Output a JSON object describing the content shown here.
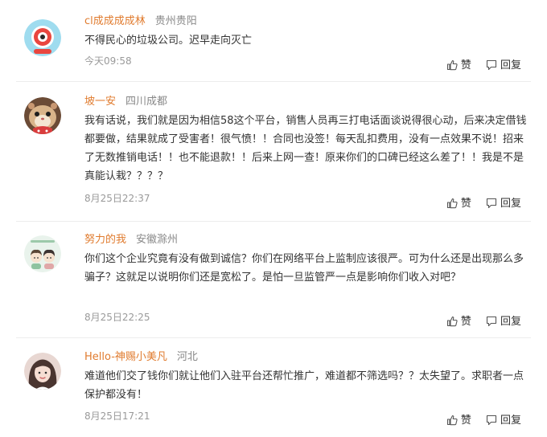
{
  "comments": [
    {
      "username": "cl成成成成林",
      "location": "贵州贵阳",
      "text": "不得民心的垃圾公司。迟早走向灭亡",
      "time": "今天09:58",
      "like_label": "赞",
      "reply_label": "回复"
    },
    {
      "username": "坡一安",
      "location": "四川成都",
      "text": "我有话说，我们就是因为相信58这个平台，销售人员再三打电话面谈说得很心动，后来决定借钱都要做，结果就成了受害者！很气愤！！合同也没签！每天乱扣费用，没有一点效果不说！招来了无数推销电话！！也不能退款！！后来上网一查！原来你们的口碑已经这么差了！！我是不是真能认栽？？？？",
      "time": "8月25日22:37",
      "like_label": "赞",
      "reply_label": "回复"
    },
    {
      "username": "努力的我",
      "location": "安徽滁州",
      "text": "你们这个企业究竟有没有做到诚信？你们在网络平台上监制应该很严。可为什么还是出现那么多骗子？这就足以说明你们还是宽松了。是怕一旦监管严一点是影响你们收入对吧？",
      "time": "8月25日22:25",
      "like_label": "赞",
      "reply_label": "回复"
    },
    {
      "username": "Hello-神赐小美凡",
      "location": "河北",
      "text": "难道他们交了钱你们就让他们入驻平台还帮忙推广，难道都不筛选吗？？太失望了。求职者一点保护都没有！",
      "time": "8月25日17:21",
      "like_label": "赞",
      "reply_label": "回复"
    }
  ],
  "colors": {
    "username": "#e07b2e",
    "location": "#888888",
    "text": "#333333",
    "time": "#9a9a9a",
    "divider": "#ececec"
  },
  "icons": [
    "weibo-default-avatar-icon",
    "hamster-avatar-icon",
    "cartoon-couple-avatar-icon",
    "girl-avatar-icon",
    "thumbs-up-icon",
    "reply-icon"
  ]
}
